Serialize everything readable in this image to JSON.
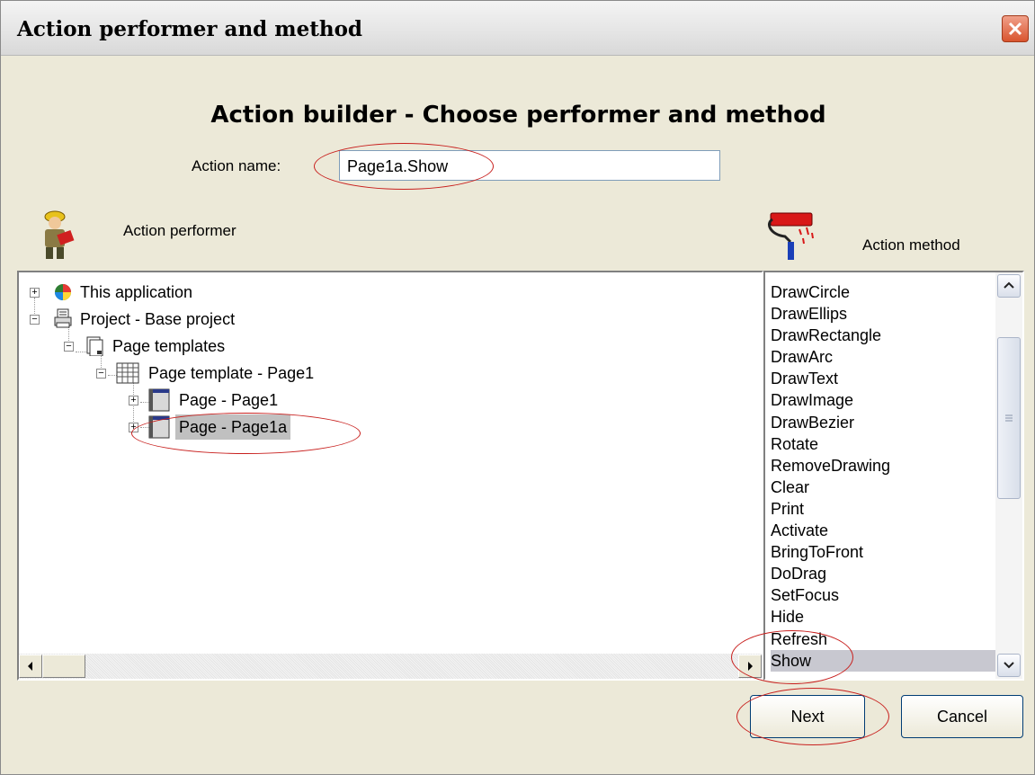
{
  "window": {
    "title": "Action performer and method"
  },
  "heading": "Action builder - Choose performer and method",
  "action_name": {
    "label": "Action name:",
    "value": "Page1a.Show"
  },
  "performer": {
    "label": "Action performer",
    "tree": [
      {
        "label": "This application",
        "icon": "rainbow-app-icon",
        "expander": "+"
      },
      {
        "label": "Project - Base project",
        "icon": "printer-project-icon",
        "expander": "−"
      },
      {
        "label": "Page templates",
        "icon": "page-templates-icon",
        "expander": "−"
      },
      {
        "label": "Page template - Page1",
        "icon": "grid-page-template-icon",
        "expander": "−"
      },
      {
        "label": "Page - Page1",
        "icon": "page-icon",
        "expander": "+"
      },
      {
        "label": "Page - Page1a",
        "icon": "page-icon",
        "expander": "+",
        "selected": true
      }
    ]
  },
  "method": {
    "label": "Action method",
    "items": [
      "DrawCircle",
      "DrawEllips",
      "DrawRectangle",
      "DrawArc",
      "DrawText",
      "DrawImage",
      "DrawBezier",
      "Rotate",
      "RemoveDrawing",
      "Clear",
      "Print",
      "Activate",
      "BringToFront",
      "DoDrag",
      "SetFocus",
      "Hide",
      "Refresh",
      "Show"
    ],
    "selected": "Show"
  },
  "buttons": {
    "next": "Next",
    "cancel": "Cancel"
  },
  "colors": {
    "highlight_ellipse": "#c8201e",
    "dialog_bg": "#ece9d8",
    "selection": "#c0c0c0"
  }
}
